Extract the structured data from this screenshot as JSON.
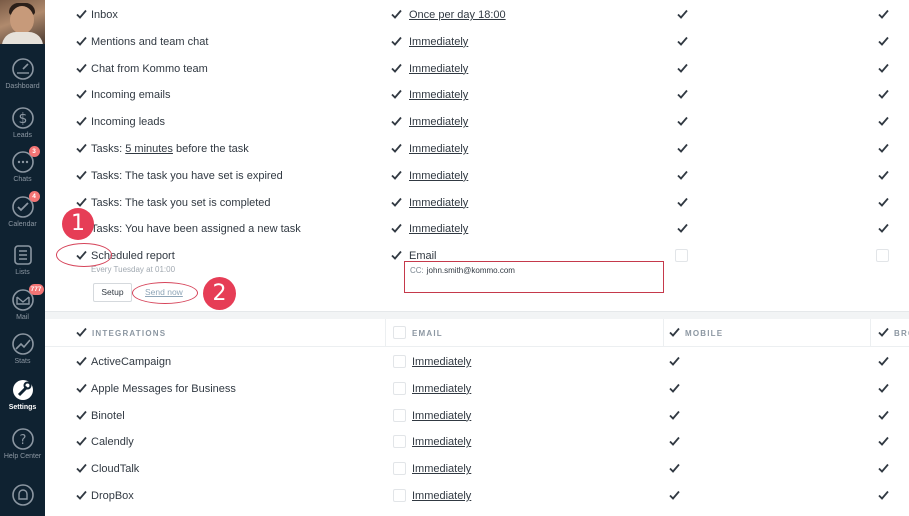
{
  "sidebar": {
    "items": [
      {
        "label": "Dashboard",
        "icon": "speedometer-icon"
      },
      {
        "label": "Leads",
        "icon": "dollar-icon"
      },
      {
        "label": "Chats",
        "icon": "chat-icon",
        "badge": "3"
      },
      {
        "label": "Calendar",
        "icon": "check-circle-icon",
        "badge": "4"
      },
      {
        "label": "Lists",
        "icon": "list-icon"
      },
      {
        "label": "Mail",
        "icon": "mail-icon",
        "badge": "777"
      },
      {
        "label": "Stats",
        "icon": "stats-icon"
      },
      {
        "label": "Settings",
        "icon": "settings-icon"
      },
      {
        "label": "Help Center",
        "icon": "help-icon"
      },
      {
        "label": "",
        "icon": "bell-icon"
      }
    ]
  },
  "notifications": [
    {
      "name": "Inbox",
      "frequency": "Once per day 18:00"
    },
    {
      "name": "Mentions and team chat",
      "frequency": "Immediately"
    },
    {
      "name": "Chat from Kommo team",
      "frequency": "Immediately"
    },
    {
      "name": "Incoming emails",
      "frequency": "Immediately"
    },
    {
      "name": "Incoming leads",
      "frequency": "Immediately"
    },
    {
      "name_prefix": "Tasks: ",
      "name_link": "5 minutes",
      "name_suffix": " before the task",
      "frequency": "Immediately"
    },
    {
      "name": "Tasks: The task you have set is expired",
      "frequency": "Immediately"
    },
    {
      "name": "Tasks: The task you set is completed",
      "frequency": "Immediately"
    },
    {
      "name": "Tasks: You have been assigned a new task",
      "frequency": "Immediately"
    }
  ],
  "scheduled_report": {
    "name": "Scheduled report",
    "schedule": "Every Tuesday at 01:00",
    "channel": "Email",
    "setup_label": "Setup",
    "send_now_label": "Send now",
    "cc_label": "CC:",
    "cc_value": "john.smith@kommo.com"
  },
  "annotations": {
    "one": "1",
    "two": "2"
  },
  "integrations": {
    "headers": {
      "integrations": "INTEGRATIONS",
      "email": "EMAIL",
      "mobile": "MOBILE",
      "browser": "BRO"
    },
    "items": [
      {
        "name": "ActiveCampaign",
        "frequency": "Immediately"
      },
      {
        "name": "Apple Messages for Business",
        "frequency": "Immediately"
      },
      {
        "name": "Binotel",
        "frequency": "Immediately"
      },
      {
        "name": "Calendly",
        "frequency": "Immediately"
      },
      {
        "name": "CloudTalk",
        "frequency": "Immediately"
      },
      {
        "name": "DropBox",
        "frequency": "Immediately"
      }
    ]
  },
  "colors": {
    "sidebar": "#0f2231",
    "accent": "#e63d56",
    "text": "#313942",
    "muted": "#a1a9b1"
  }
}
